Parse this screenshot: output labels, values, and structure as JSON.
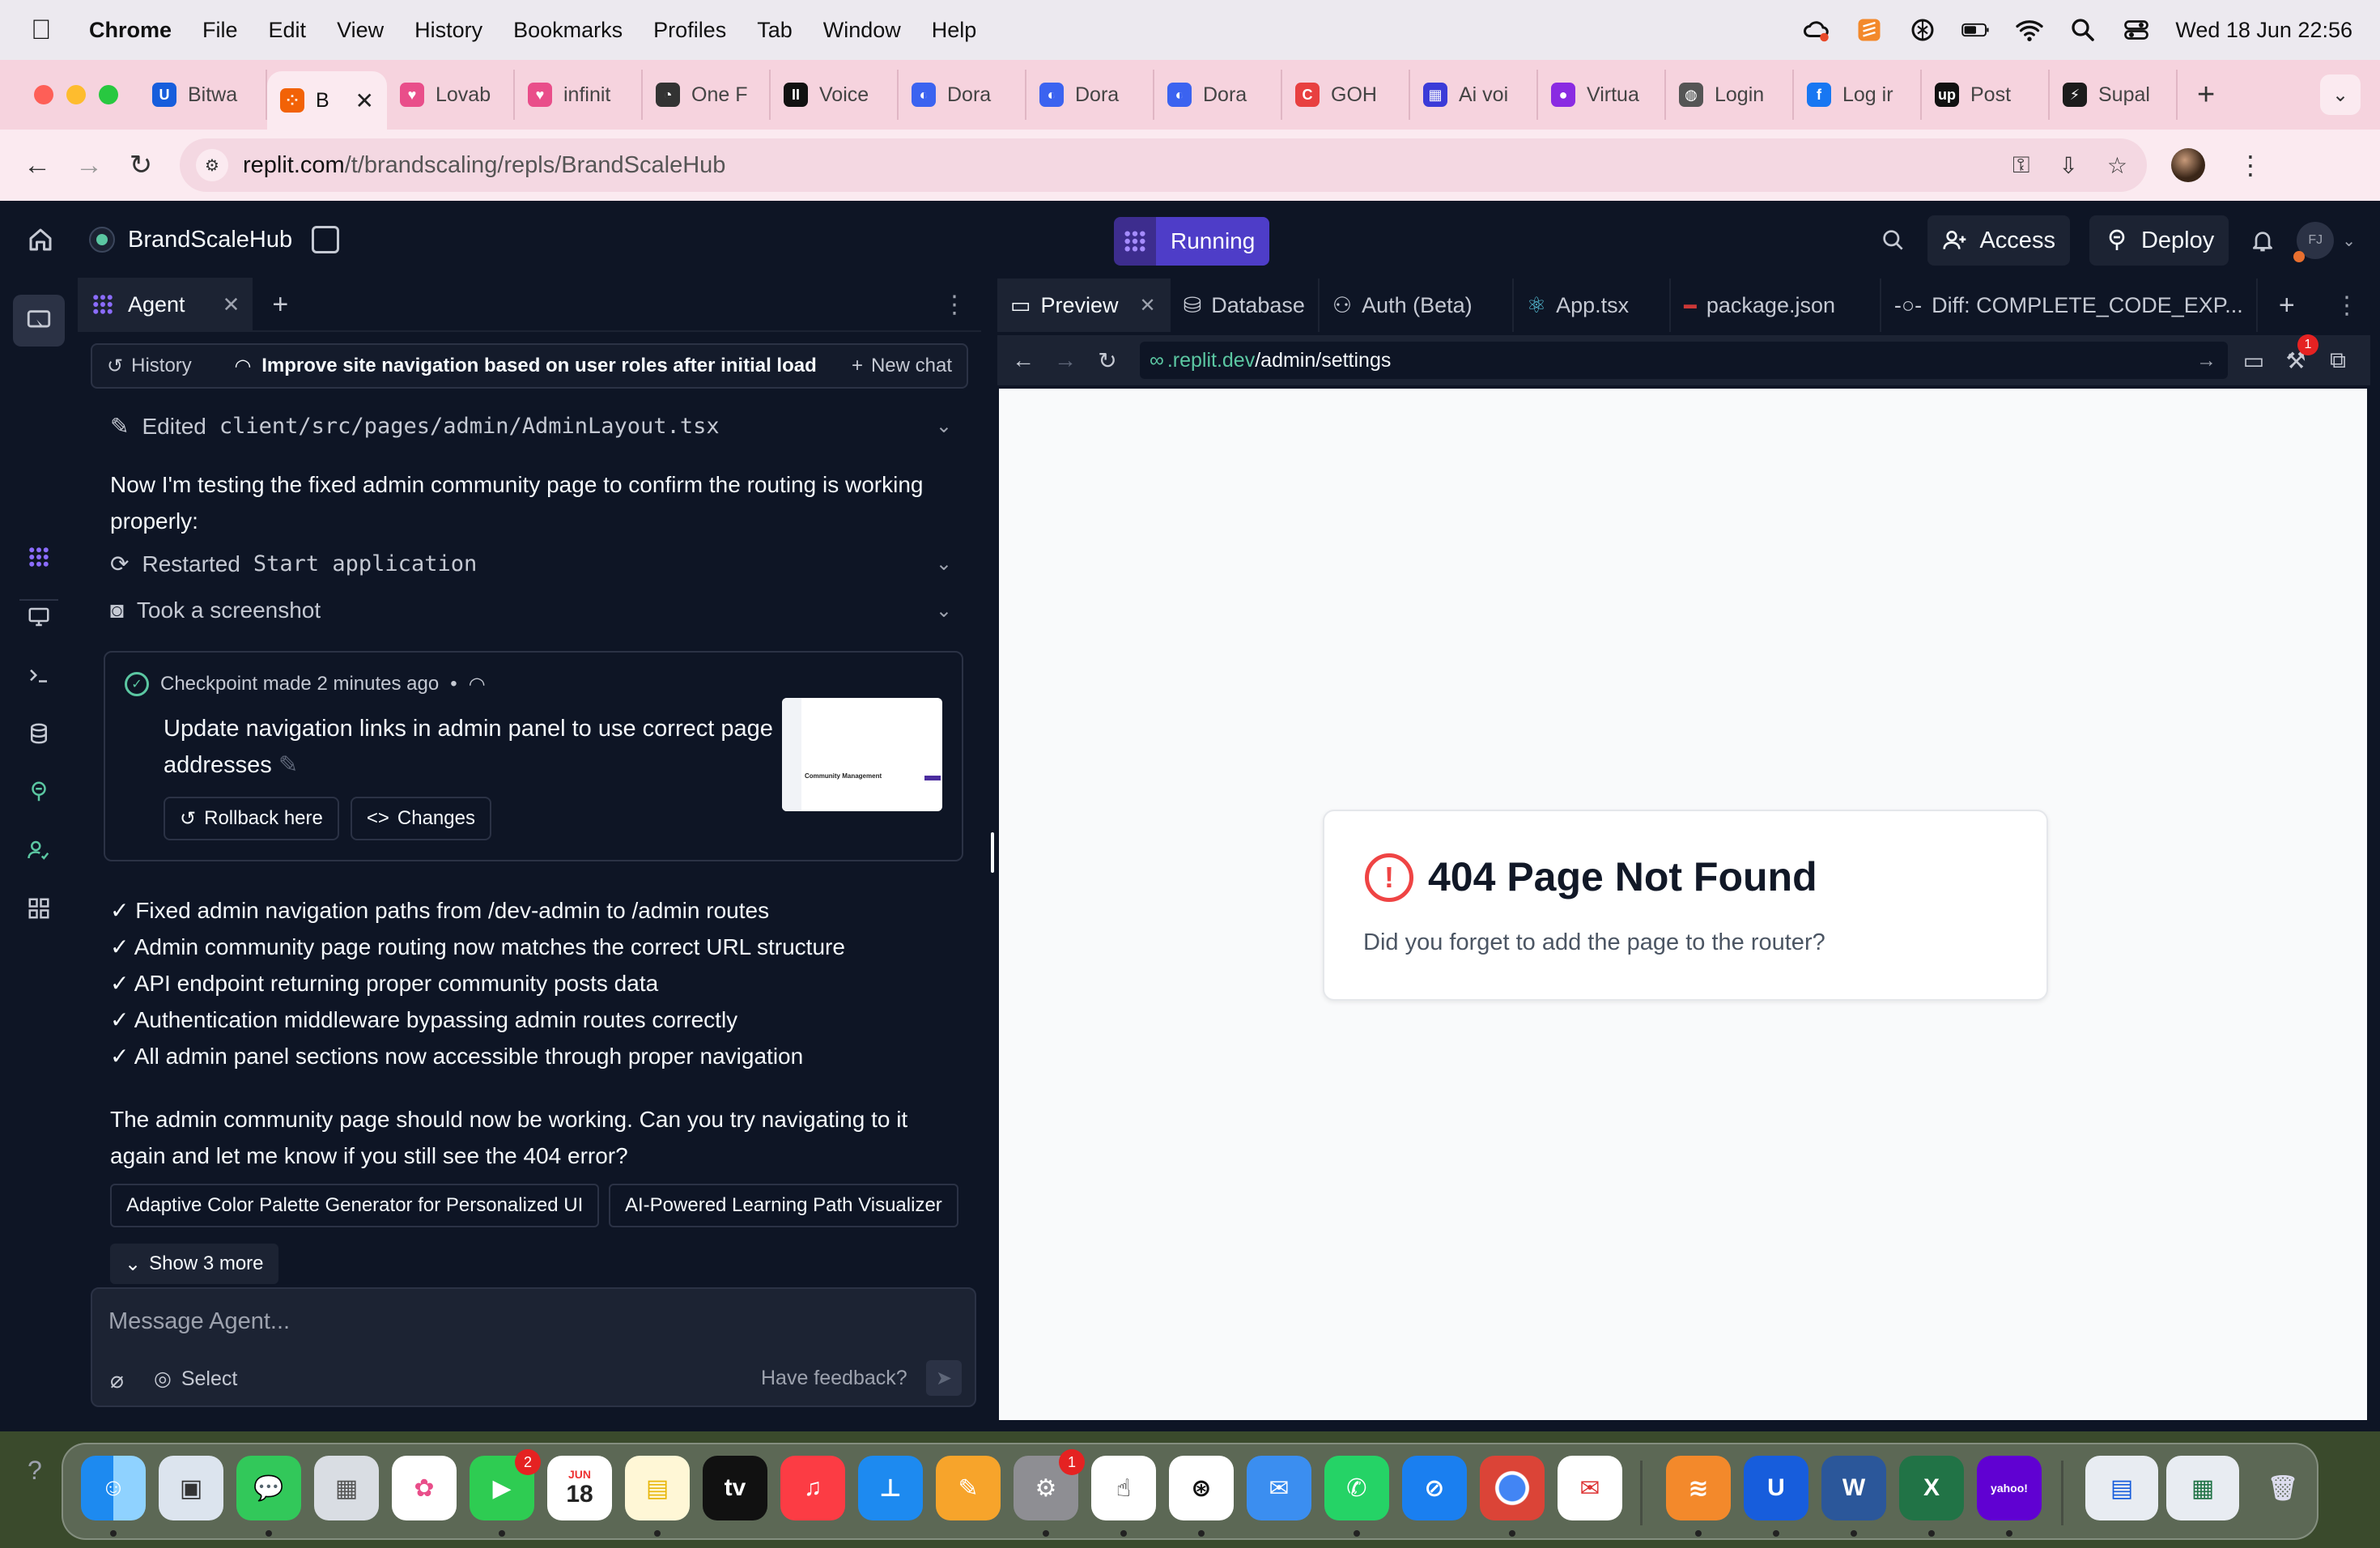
{
  "menubar": {
    "app_name": "Chrome",
    "menus": [
      "File",
      "Edit",
      "View",
      "History",
      "Bookmarks",
      "Profiles",
      "Tab",
      "Window",
      "Help"
    ],
    "datetime": "Wed 18 Jun  22:56"
  },
  "tabs": [
    {
      "label": "Bitwa",
      "color": "#175ddc",
      "glyph": "U"
    },
    {
      "label": "B",
      "color": "#f26207",
      "glyph": "⁘",
      "active": true
    },
    {
      "label": "Lovab",
      "color": "#e94e8a",
      "glyph": "♥"
    },
    {
      "label": "infinit",
      "color": "#e94e8a",
      "glyph": "♥"
    },
    {
      "label": "One F",
      "color": "#333333",
      "glyph": "◔"
    },
    {
      "label": "Voice",
      "color": "#111111",
      "glyph": "II"
    },
    {
      "label": "Dora",
      "color": "#3b63f0",
      "glyph": "◐"
    },
    {
      "label": "Dora",
      "color": "#3b63f0",
      "glyph": "◐"
    },
    {
      "label": "Dora",
      "color": "#3b63f0",
      "glyph": "◐"
    },
    {
      "label": "GOH",
      "color": "#e84040",
      "glyph": "C"
    },
    {
      "label": "Ai voi",
      "color": "#3b3bd8",
      "glyph": "▦"
    },
    {
      "label": "Virtua",
      "color": "#8a2be2",
      "glyph": "●"
    },
    {
      "label": "Login",
      "color": "#555555",
      "glyph": "◍"
    },
    {
      "label": "Log ir",
      "color": "#1877f2",
      "glyph": "f"
    },
    {
      "label": "Post",
      "color": "#111111",
      "glyph": "up"
    },
    {
      "label": "Supal",
      "color": "#1c1c1c",
      "glyph": "⚡"
    }
  ],
  "omnibox": {
    "host": "replit.com",
    "path": "/t/brandscaling/repls/BrandScaleHub"
  },
  "replit": {
    "project_name": "BrandScaleHub",
    "run_label": "Running",
    "access_label": "Access",
    "deploy_label": "Deploy",
    "user_initials": "FJ",
    "agent_tab": "Agent",
    "history_label": "History",
    "chat_title": "Improve site navigation based on user roles after initial load",
    "new_chat_label": "New chat",
    "edited_prefix": "Edited",
    "edited_file": "client/src/pages/admin/AdminLayout.tsx",
    "message1": "Now I'm testing the fixed admin community page to confirm the routing is working properly:",
    "restarted_prefix": "Restarted",
    "restarted_target": "Start application",
    "screenshot_label": "Took a screenshot",
    "checkpoint_head": "Checkpoint made 2 minutes ago",
    "checkpoint_sep": "•",
    "checkpoint_title": "Update navigation links in admin panel to use correct page addresses",
    "rollback_label": "Rollback here",
    "changes_label": "Changes",
    "thumb_text": "Community Management",
    "bullets": [
      "✓ Fixed admin navigation paths from /dev-admin to /admin routes",
      "✓ Admin community page routing now matches the correct URL structure",
      "✓ API endpoint returning proper community posts data",
      "✓ Authentication middleware bypassing admin routes correctly",
      "✓ All admin panel sections now accessible through proper navigation"
    ],
    "message2": "The admin community page should now be working. Can you try navigating to it again and let me know if you still see the 404 error?",
    "suggestions": [
      "Adaptive Color Palette Generator for Personalized UI",
      "AI-Powered Learning Path Visualizer"
    ],
    "show_more_label": "Show 3 more",
    "composer_placeholder": "Message Agent...",
    "select_label": "Select",
    "feedback_label": "Have feedback?",
    "right_tabs": [
      "Preview",
      "Database",
      "Auth (Beta)",
      "App.tsx",
      "package.json",
      "Diff: COMPLETE_CODE_EXP..."
    ],
    "preview_url_domain": ".replit.dev",
    "preview_url_path": "/admin/settings",
    "devtools_badge": "1",
    "notfound_title": "404 Page Not Found",
    "notfound_text": "Did you forget to add the page to the router?"
  },
  "dock": {
    "facetime_badge": "2",
    "settings_badge": "1",
    "calendar_month": "JUN",
    "calendar_day": "18",
    "tv_label": "tv",
    "word_letter": "W",
    "excel_letter": "X",
    "yahoo_label": "yahoo!"
  }
}
